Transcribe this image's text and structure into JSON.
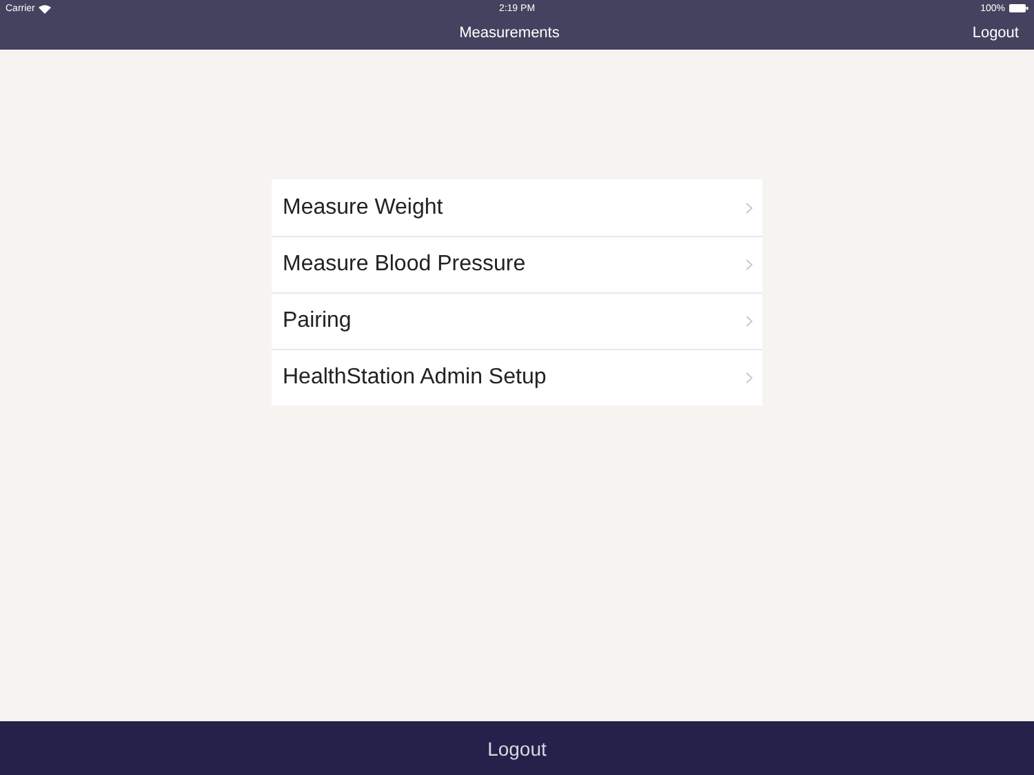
{
  "status_bar": {
    "carrier": "Carrier",
    "time": "2:19 PM",
    "battery": "100%"
  },
  "nav_bar": {
    "title": "Measurements",
    "right_button": "Logout"
  },
  "menu": {
    "items": [
      {
        "label": "Measure Weight"
      },
      {
        "label": "Measure Blood Pressure"
      },
      {
        "label": "Pairing"
      },
      {
        "label": "HealthStation Admin Setup"
      }
    ]
  },
  "footer": {
    "button": "Logout"
  }
}
